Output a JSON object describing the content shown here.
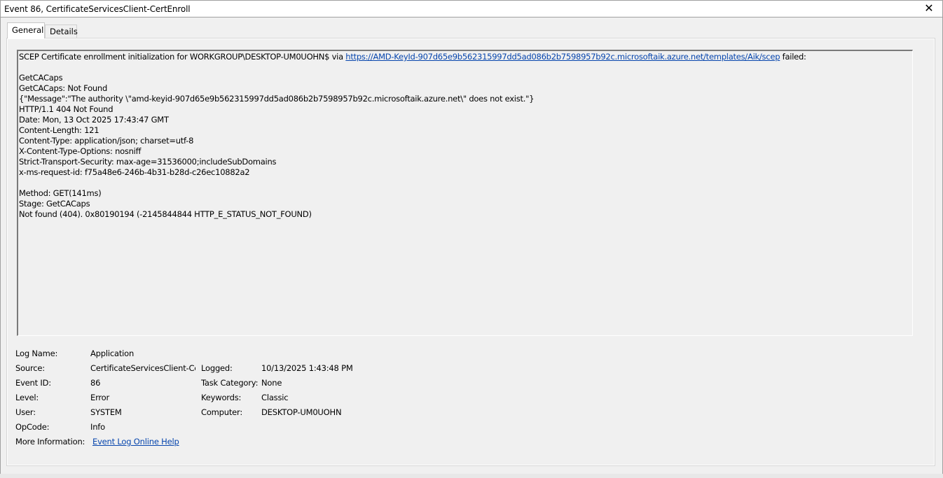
{
  "window": {
    "title": "Event 86, CertificateServicesClient-CertEnroll",
    "close_glyph": "✕"
  },
  "tabs": [
    {
      "label": "General",
      "active": true
    },
    {
      "label": "Details",
      "active": false
    }
  ],
  "message": {
    "line1_prefix": "SCEP Certificate enrollment initialization for WORKGROUP\\DESKTOP-UM0UOHN$ via ",
    "line1_link": "https://AMD-KeyId-907d65e9b562315997dd5ad086b2b7598957b92c.microsoftaik.azure.net/templates/Aik/scep",
    "line1_suffix": " failed:",
    "lines": [
      "GetCACaps",
      "GetCACaps: Not Found",
      "{\"Message\":\"The authority \\\"amd-keyid-907d65e9b562315997dd5ad086b2b7598957b92c.microsoftaik.azure.net\\\" does not exist.\"}",
      "HTTP/1.1 404 Not Found",
      "Date: Mon, 13 Oct 2025 17:43:47 GMT",
      "Content-Length: 121",
      "Content-Type: application/json; charset=utf-8",
      "X-Content-Type-Options: nosniff",
      "Strict-Transport-Security: max-age=31536000;includeSubDomains",
      "x-ms-request-id: f75a48e6-246b-4b31-b28d-c26ec10882a2",
      "Method: GET(141ms)",
      "Stage: GetCACaps",
      "Not found (404). 0x80190194 (-2145844844 HTTP_E_STATUS_NOT_FOUND)"
    ]
  },
  "properties": {
    "log_name_label": "Log Name:",
    "log_name": "Application",
    "source_label": "Source:",
    "source": "CertificateServicesClient-Cer",
    "logged_label": "Logged:",
    "logged": "10/13/2025 1:43:48 PM",
    "event_id_label": "Event ID:",
    "event_id": "86",
    "task_category_label": "Task Category:",
    "task_category": "None",
    "level_label": "Level:",
    "level": "Error",
    "keywords_label": "Keywords:",
    "keywords": "Classic",
    "user_label": "User:",
    "user": "SYSTEM",
    "computer_label": "Computer:",
    "computer": "DESKTOP-UM0UOHN",
    "opcode_label": "OpCode:",
    "opcode": "Info",
    "more_info_label": "More Information:",
    "more_info_link": "Event Log Online Help"
  }
}
